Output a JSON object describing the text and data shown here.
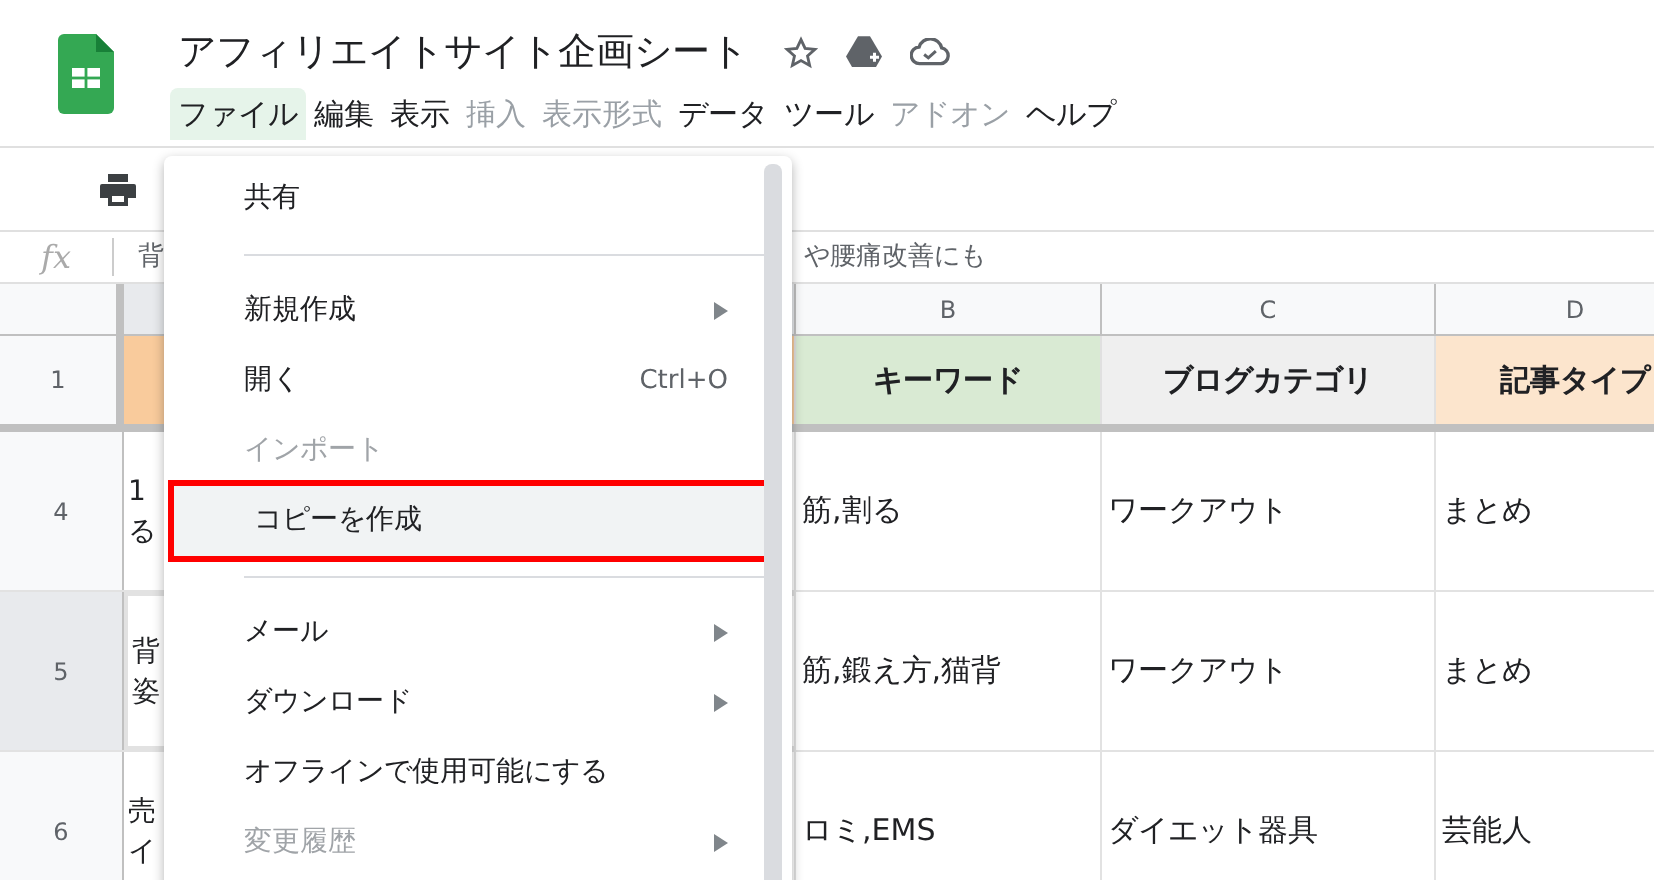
{
  "document": {
    "title": "アフィリエイトサイト企画シート"
  },
  "menubar": [
    {
      "label": "ファイル",
      "selected": true,
      "disabled": false
    },
    {
      "label": "編集",
      "selected": false,
      "disabled": false
    },
    {
      "label": "表示",
      "selected": false,
      "disabled": false
    },
    {
      "label": "挿入",
      "selected": false,
      "disabled": true
    },
    {
      "label": "表示形式",
      "selected": false,
      "disabled": true
    },
    {
      "label": "データ",
      "selected": false,
      "disabled": false
    },
    {
      "label": "ツール",
      "selected": false,
      "disabled": false
    },
    {
      "label": "アドオン",
      "selected": false,
      "disabled": true
    },
    {
      "label": "ヘルプ",
      "selected": false,
      "disabled": false
    }
  ],
  "formula_bar": {
    "label": "fx",
    "value_start": "背",
    "value_end": "や腰痛改善にも"
  },
  "sheet": {
    "columns": [
      "B",
      "C",
      "D"
    ],
    "header_row": {
      "number": "1",
      "cells": [
        "キーワード",
        "ブログカテゴリ",
        "記事タイプ"
      ]
    },
    "rows": [
      {
        "number": "4",
        "selected": false,
        "column_a": [
          "1",
          "る"
        ],
        "cells": [
          "筋,割る",
          "ワークアウト",
          "まとめ"
        ]
      },
      {
        "number": "5",
        "selected": true,
        "column_a": [
          "背",
          "姿"
        ],
        "cells": [
          "筋,鍛え方,猫背",
          "ワークアウト",
          "まとめ"
        ]
      },
      {
        "number": "6",
        "selected": false,
        "column_a": [
          "売",
          "イ"
        ],
        "cells": [
          "ロミ,EMS",
          "ダイエット器具",
          "芸能人"
        ]
      }
    ]
  },
  "file_menu": [
    {
      "kind": "item",
      "label": "共有",
      "disabled": false,
      "submenu": false,
      "highlighted": false
    },
    {
      "kind": "divider"
    },
    {
      "kind": "item",
      "label": "新規作成",
      "disabled": false,
      "submenu": true,
      "highlighted": false
    },
    {
      "kind": "item",
      "label": "開く",
      "shortcut": "Ctrl+O",
      "disabled": false,
      "submenu": false,
      "highlighted": false
    },
    {
      "kind": "item",
      "label": "インポート",
      "disabled": true,
      "submenu": false,
      "highlighted": false
    },
    {
      "kind": "item",
      "label": "コピーを作成",
      "disabled": false,
      "submenu": false,
      "highlighted": true
    },
    {
      "kind": "divider"
    },
    {
      "kind": "item",
      "label": "メール",
      "disabled": false,
      "submenu": true,
      "highlighted": false
    },
    {
      "kind": "item",
      "label": "ダウンロード",
      "disabled": false,
      "submenu": true,
      "highlighted": false
    },
    {
      "kind": "item",
      "label": "オフラインで使用可能にする",
      "disabled": false,
      "submenu": false,
      "highlighted": false
    },
    {
      "kind": "item",
      "label": "変更履歴",
      "disabled": true,
      "submenu": true,
      "highlighted": false
    }
  ]
}
